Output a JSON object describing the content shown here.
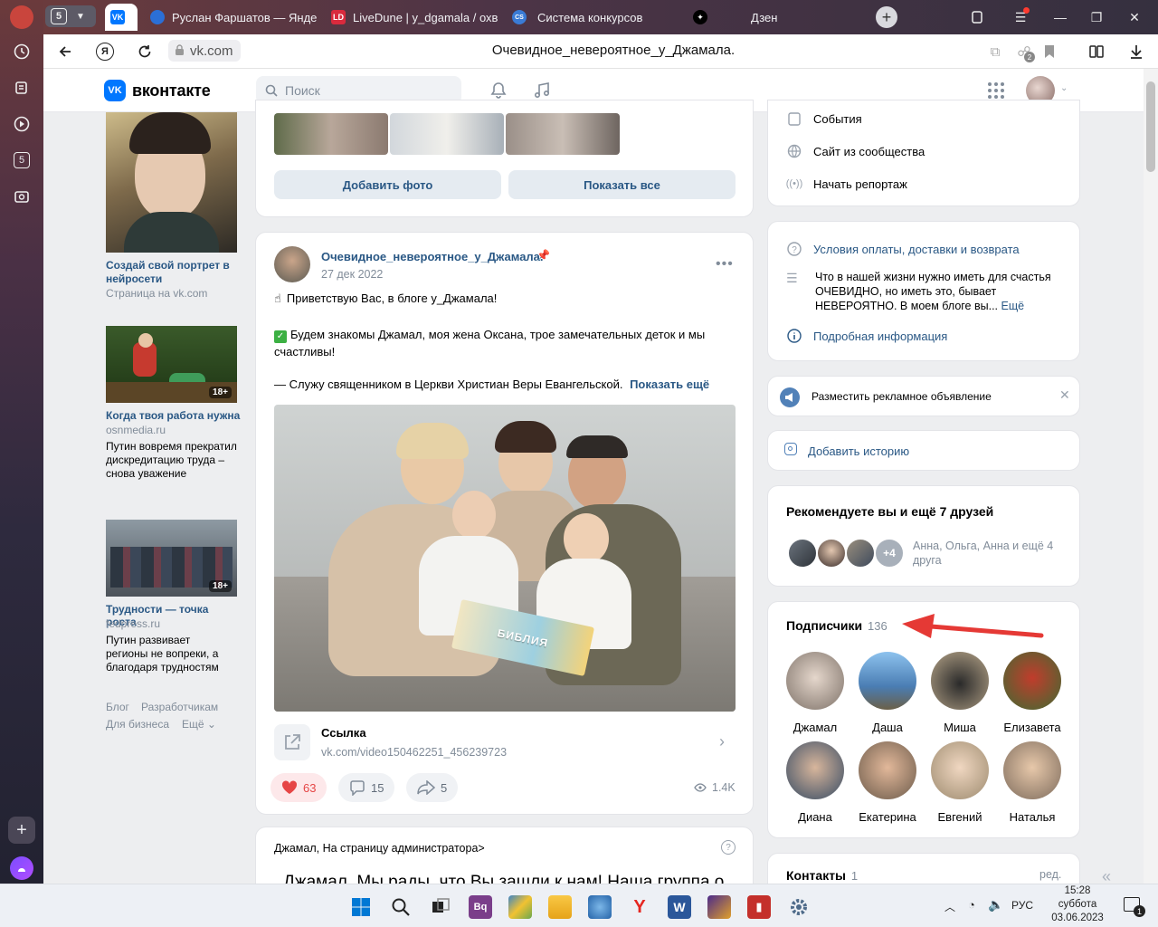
{
  "browser": {
    "tab_counter": "5",
    "tabs": [
      {
        "title": "",
        "favicon": "VK"
      },
      {
        "title": "Руслан Фаршатов — Янде",
        "favicon": "Y"
      },
      {
        "title": "LiveDune | y_dgamala / охв",
        "favicon": "LD"
      },
      {
        "title": "Система конкурсов",
        "favicon": "CS"
      },
      {
        "title": "Дзен",
        "favicon": "Д"
      }
    ],
    "url": "vk.com",
    "page_title": "Очевидное_невероятное_у_Джамала.",
    "tab_badge": "2",
    "sidebar_badge": "5"
  },
  "vk": {
    "logo_text": "вконтакте",
    "search_placeholder": "Поиск"
  },
  "left_ads": [
    {
      "title": "Создай свой портрет в нейросети",
      "domain": "Страница на vk.com",
      "text": ""
    },
    {
      "title": "Когда твоя работа нужна",
      "domain": "osnmedia.ru",
      "text": "Путин вовремя прекратил дискредитацию труда – снова уважение",
      "badge": "18+"
    },
    {
      "title": "Трудности — точка роста",
      "domain": "fedpress.ru",
      "text": "Путин развивает регионы не вопреки, а благодаря трудностям",
      "badge": "18+"
    }
  ],
  "left_footer": {
    "links": [
      "Блог",
      "Разработчикам",
      "Для бизнеса",
      "Ещё"
    ]
  },
  "photos_block": {
    "add_photo": "Добавить фото",
    "show_all": "Показать все"
  },
  "post": {
    "author": "Очевидное_невероятное_у_Джамала.",
    "date": "27 дек 2022",
    "line1": "Приветствую Вас, в блоге у_Джамала!",
    "line2": "Будем знакомы Джамал, моя жена Оксана, трое замечательных деток и мы счастливы!",
    "line3": "— Служу священником в Церкви Христиан Веры Евангельской.",
    "show_more": "Показать ещё",
    "book_text": "БИБЛИЯ",
    "link_title": "Ссылка",
    "link_url": "vk.com/video150462251_456239723",
    "likes": "63",
    "comments": "15",
    "shares": "5",
    "views": "1.4K"
  },
  "next_post": {
    "header": "Джамал, На страницу администратора>",
    "text": "Джамал, Мы рады, что Вы зашли к нам! Наша группа о"
  },
  "right": {
    "actions": [
      "События",
      "Сайт из сообщества",
      "Начать репортаж"
    ],
    "info": {
      "terms": "Условия оплаты, доставки и возврата",
      "desc": "Что в нашей жизни нужно иметь для счастья ОЧЕВИДНО, но иметь это, бывает НЕВЕРОЯТНО. В моем блоге вы...",
      "desc_more": "Ещё",
      "details": "Подробная информация"
    },
    "ad": "Разместить рекламное объявление",
    "story": "Добавить историю",
    "recommend": {
      "title": "Рекомендуете вы и ещё 7 друзей",
      "plus": "+4",
      "names": "Анна, Ольга, Анна и ещё 4 друга"
    },
    "subscribers": {
      "title": "Подписчики",
      "count": "136",
      "list": [
        "Джамал",
        "Даша",
        "Миша",
        "Елизавета",
        "Диана",
        "Екатерина",
        "Евгений",
        "Наталья"
      ]
    },
    "contacts": {
      "title": "Контакты",
      "count": "1",
      "edit": "ред."
    }
  },
  "taskbar": {
    "lang": "РУС",
    "time": "15:28",
    "day": "суббота",
    "date": "03.06.2023",
    "notif": "1"
  },
  "colors": {
    "vk_blue": "#0077ff",
    "link": "#2a5885",
    "arrow": "#e53935",
    "like": "#e64646"
  }
}
